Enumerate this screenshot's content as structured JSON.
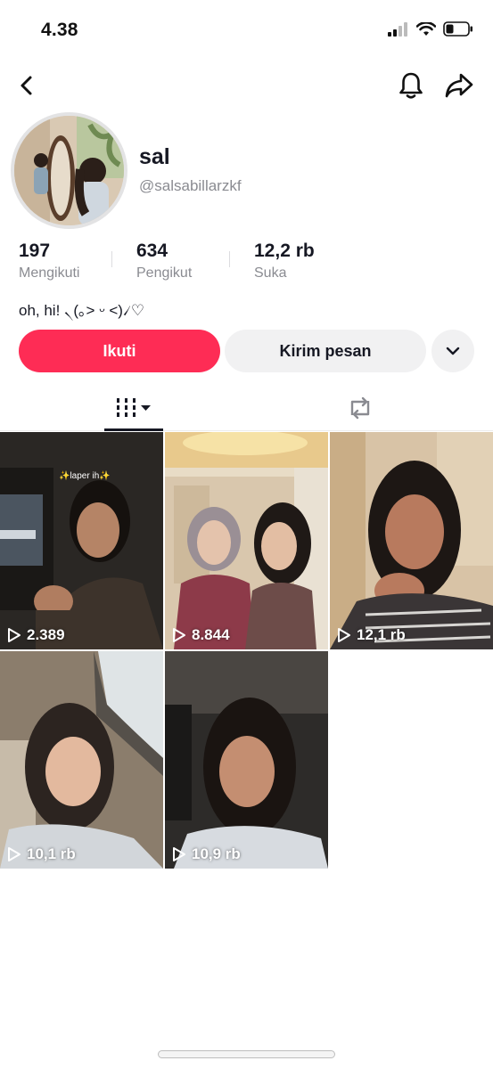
{
  "status_bar": {
    "time": "4.38"
  },
  "profile": {
    "display_name": "sal",
    "username": "@salsabillarzkf",
    "bio": "oh, hi! ৲(｡˃ ᵕ ˂)৴♡",
    "stats": [
      {
        "value": "197",
        "label": "Mengikuti"
      },
      {
        "value": "634",
        "label": "Pengikut"
      },
      {
        "value": "12,2 rb",
        "label": "Suka"
      }
    ]
  },
  "actions": {
    "follow_label": "Ikuti",
    "message_label": "Kirim pesan"
  },
  "tabs": {
    "active": "videos",
    "icons": [
      "grid-icon",
      "repost-icon"
    ]
  },
  "videos": [
    {
      "views": "2.389",
      "caption": "✨laper ih✨"
    },
    {
      "views": "8.844"
    },
    {
      "views": "12,1 rb"
    },
    {
      "views": "10,1 rb"
    },
    {
      "views": "10,9 rb"
    }
  ],
  "colors": {
    "accent": "#fe2c55",
    "secondary_button": "#f1f1f2",
    "muted_text": "#8a8b91",
    "text": "#161823"
  }
}
